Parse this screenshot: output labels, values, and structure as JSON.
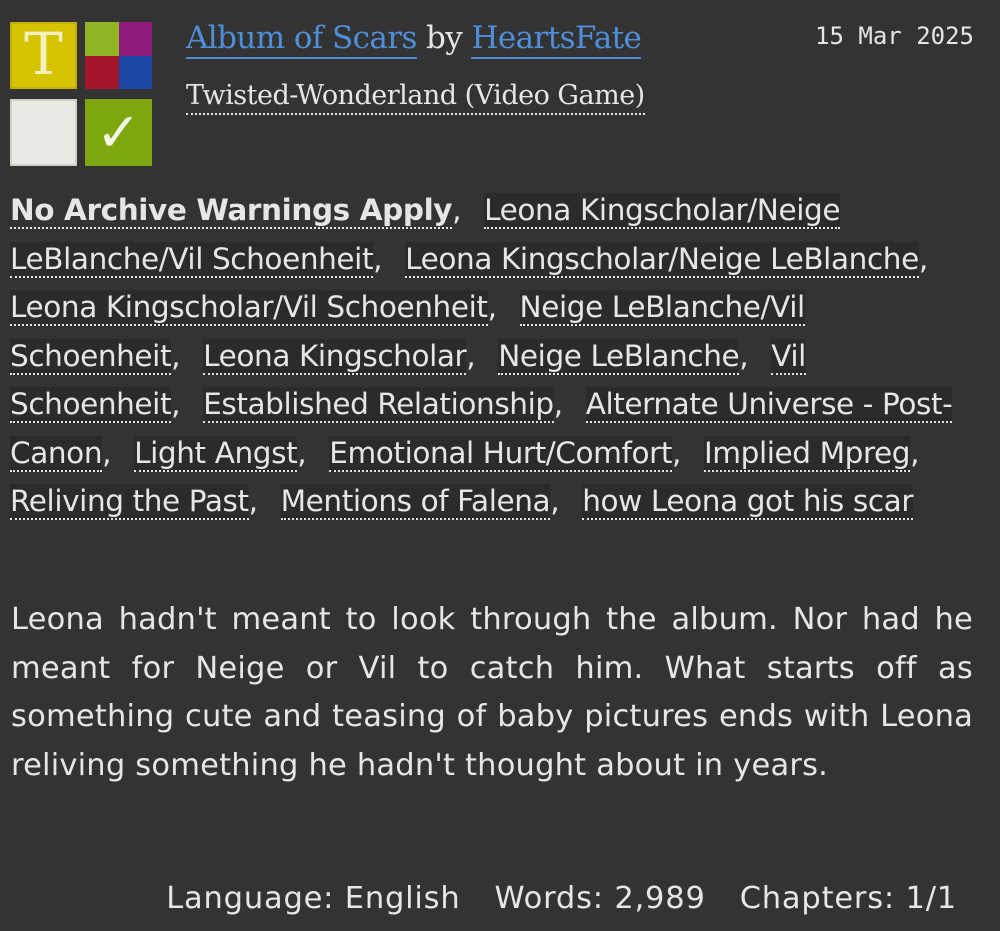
{
  "work": {
    "title": "Album of Scars",
    "by": "by",
    "author": "HeartsFate",
    "fandom": "Twisted-Wonderland (Video Game)",
    "date": "15 Mar 2025",
    "required_tags": {
      "rating_letter": "T",
      "complete_mark": "✓",
      "rating_icon": "rating-teen-icon",
      "category_icon": "category-multi-icon",
      "warning_icon": "no-warnings-icon",
      "status_icon": "complete-icon",
      "colors": {
        "rating": "#d6c300",
        "category": [
          "#8fb526",
          "#8e1a7b",
          "#a4172b",
          "#1d47a6"
        ],
        "warning": "#e9e9e4",
        "complete": "#7ea60f"
      }
    }
  },
  "tags": [
    "No Archive Warnings Apply",
    "Leona Kingscholar/Neige LeBlanche/Vil Schoenheit",
    "Leona Kingscholar/Neige LeBlanche",
    "Leona Kingscholar/Vil Schoenheit",
    "Neige LeBlanche/Vil Schoenheit",
    "Leona Kingscholar",
    "Neige LeBlanche",
    "Vil Schoenheit",
    "Established Relationship",
    "Alternate Universe - Post-Canon",
    "Light Angst",
    "Emotional Hurt/Comfort",
    "Implied Mpreg",
    "Reliving the Past",
    "Mentions of Falena",
    "how Leona got his scar"
  ],
  "tag_separator": ",",
  "summary": "Leona hadn't meant to look through the album. Nor had he meant for Neige or Vil to catch him. What starts off as something cute and teasing of baby pictures ends with Leona reliving something he hadn't thought about in years.",
  "stats": {
    "language_label": "Language:",
    "language": "English",
    "words_label": "Words:",
    "words": "2,989",
    "chapters_label": "Chapters:",
    "chapters": "1/1"
  }
}
